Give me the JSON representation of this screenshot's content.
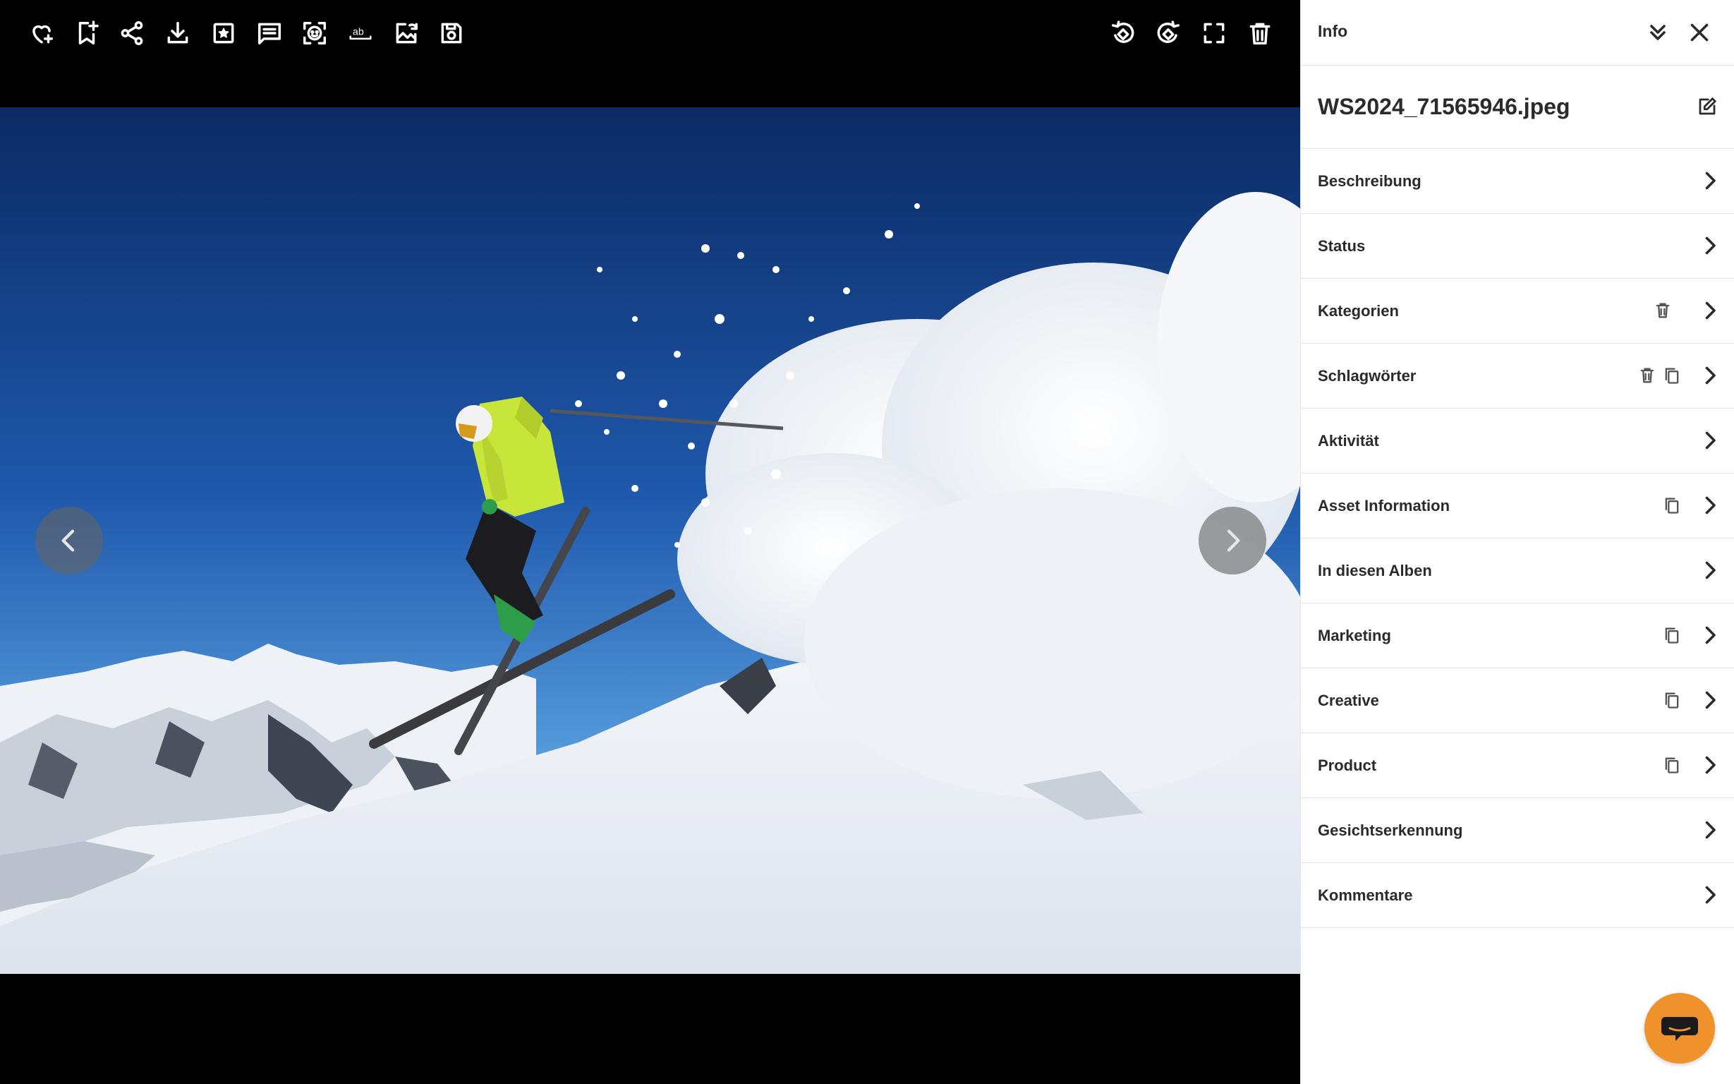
{
  "toolbar": {
    "left_icons": [
      "favorite-add-icon",
      "bookmark-add-icon",
      "share-icon",
      "download-icon",
      "star-box-icon",
      "comment-icon",
      "face-scan-icon",
      "text-recognition-icon",
      "image-replace-icon",
      "save-version-icon"
    ],
    "right_icons": [
      "rotate-left-icon",
      "rotate-right-icon",
      "fullscreen-icon",
      "delete-icon"
    ]
  },
  "viewer": {
    "prev_icon": "chevron-left-icon",
    "next_icon": "chevron-right-icon"
  },
  "panel": {
    "title": "Info",
    "file_name": "WS2024_71565946.jpeg",
    "sections": [
      {
        "label": "Beschreibung",
        "icons": []
      },
      {
        "label": "Status",
        "icons": []
      },
      {
        "label": "Kategorien",
        "icons": [
          "trash-icon"
        ]
      },
      {
        "label": "Schlagwörter",
        "icons": [
          "trash-icon",
          "copy-icon"
        ]
      },
      {
        "label": "Aktivität",
        "icons": []
      },
      {
        "label": "Asset Information",
        "icons": [
          "copy-icon"
        ]
      },
      {
        "label": "In diesen Alben",
        "icons": []
      },
      {
        "label": "Marketing",
        "icons": [
          "copy-icon"
        ]
      },
      {
        "label": "Creative",
        "icons": [
          "copy-icon"
        ]
      },
      {
        "label": "Product",
        "icons": [
          "copy-icon"
        ]
      },
      {
        "label": "Gesichtserkennung",
        "icons": []
      },
      {
        "label": "Kommentare",
        "icons": []
      }
    ]
  },
  "colors": {
    "accent_chat": "#f0922b",
    "panel_text": "#2b2b2b",
    "divider": "#e3e3e3"
  }
}
